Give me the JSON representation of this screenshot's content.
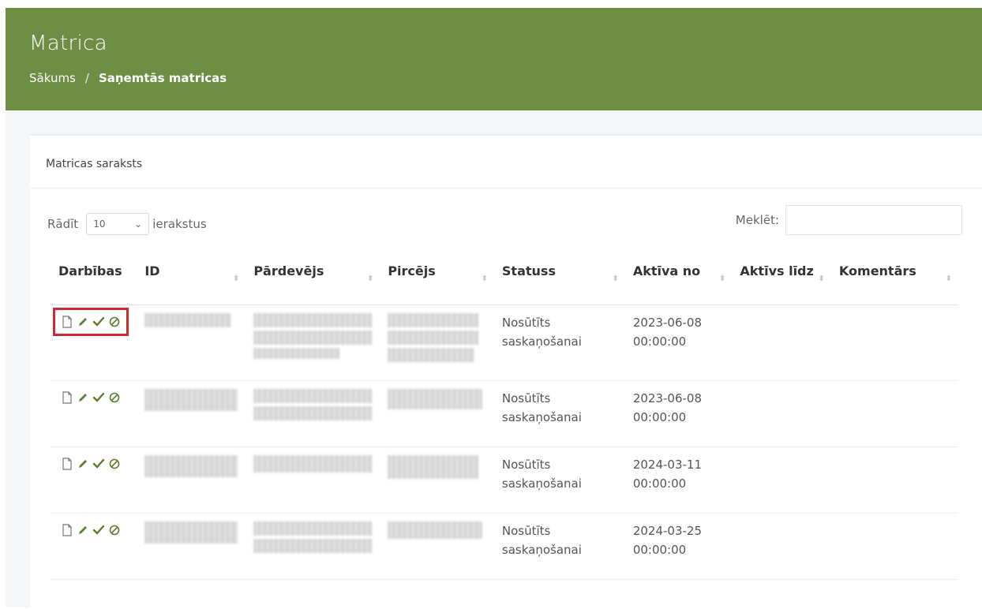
{
  "header": {
    "title": "Matrica",
    "breadcrumb": {
      "home": "Sākums",
      "separator": "/",
      "current": "Saņemtās matricas"
    }
  },
  "card": {
    "title": "Matricas saraksts"
  },
  "controls": {
    "show_label": "Rādīt",
    "page_size": "10",
    "entries_label": "ierakstus",
    "search_label": "Meklēt:",
    "search_value": ""
  },
  "table": {
    "columns": [
      "Darbības",
      "ID",
      "Pārdevējs",
      "Pircējs",
      "Statuss",
      "Aktīva no",
      "Aktīvs līdz",
      "Komentārs"
    ],
    "rows": [
      {
        "status": "Nosūtīts saskaņošanai",
        "active_from": "2023-06-08 00:00:00",
        "active_to": "",
        "comment": ""
      },
      {
        "status": "Nosūtīts saskaņošanai",
        "active_from": "2023-06-08 00:00:00",
        "active_to": "",
        "comment": ""
      },
      {
        "status": "Nosūtīts saskaņošanai",
        "active_from": "2024-03-11 00:00:00",
        "active_to": "",
        "comment": ""
      },
      {
        "status": "Nosūtīts saskaņošanai",
        "active_from": "2024-03-25 00:00:00",
        "active_to": "",
        "comment": ""
      }
    ]
  },
  "icons": [
    "document-icon",
    "pencil-icon",
    "check-icon",
    "cancel-icon"
  ],
  "colors": {
    "header_bg": "#6d8e44",
    "icon_green": "#5b7f2d",
    "highlight": "#cc2a33"
  }
}
